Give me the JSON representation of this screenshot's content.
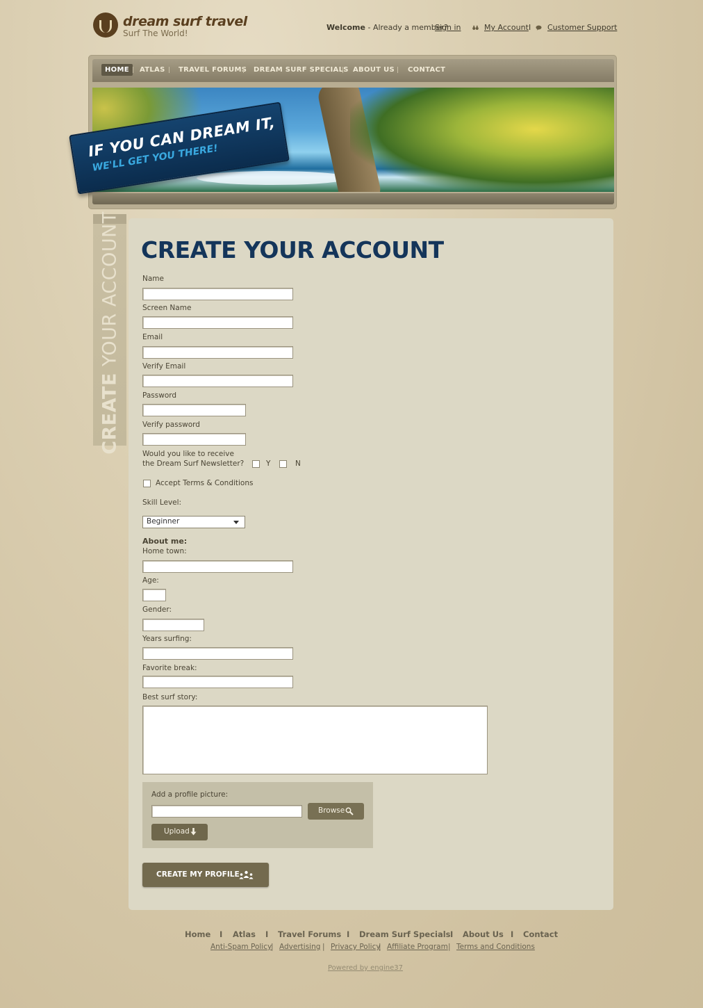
{
  "brand": {
    "name": "dream surf travel",
    "tagline": "Surf The World!"
  },
  "topbar": {
    "welcome": "Welcome",
    "member_text": "- Already a member?",
    "sign_in": "Sign in",
    "my_account": "My Account",
    "sep": "I",
    "customer_support": "Customer Support"
  },
  "nav": {
    "items": [
      "HOME",
      "ATLAS",
      "TRAVEL FORUMS",
      "DREAM SURF SPECIALS",
      "ABOUT US",
      "CONTACT"
    ],
    "active": "HOME"
  },
  "banner": {
    "line1": "IF YOU CAN DREAM IT,",
    "line2": "WE'LL GET YOU THERE!"
  },
  "sidebar": {
    "bold": "CREATE",
    "rest": "YOUR ACCOUNT"
  },
  "form": {
    "title": "CREATE YOUR ACCOUNT",
    "name_label": "Name",
    "screen_name_label": "Screen Name",
    "email_label": "Email",
    "verify_email_label": "Verify Email",
    "password_label": "Password",
    "verify_password_label": "Verify password",
    "newsletter_line1": "Would you like to receive",
    "newsletter_line2": "the Dream Surf Newsletter?",
    "newsletter_yes": "Y",
    "newsletter_no": "N",
    "terms_label": "Accept Terms & Conditions",
    "skill_label": "Skill Level:",
    "skill_value": "Beginner",
    "about_heading": "About me:",
    "hometown_label": "Home town:",
    "age_label": "Age:",
    "gender_label": "Gender:",
    "years_label": "Years surfing:",
    "break_label": "Favorite break:",
    "story_label": "Best surf story:",
    "picture_label": "Add a profile picture:",
    "browse_button": "Browse",
    "upload_button": "Upload",
    "submit_button": "CREATE MY PROFILE"
  },
  "footer": {
    "nav": [
      "Home",
      "Atlas",
      "Travel Forums",
      "Dream Surf Specials",
      "About Us",
      "Contact"
    ],
    "nav_sep": "I",
    "links": [
      "Anti-Spam Policy",
      "Advertising",
      "Privacy Policy",
      "Affiliate Program",
      "Terms and Conditions"
    ],
    "link_sep": "|",
    "powered": "Powered by engine37"
  },
  "colors": {
    "title": "#14355a",
    "panel": "#dcd8c5",
    "button": "#736a4e",
    "page_bg": "#d4c7a7"
  },
  "icons": {
    "logo": "palm-logo-icon",
    "account": "binoculars-icon",
    "support": "speech-bubble-icon",
    "browse": "magnifier-icon",
    "upload": "down-arrow-icon",
    "submit": "people-icon"
  }
}
